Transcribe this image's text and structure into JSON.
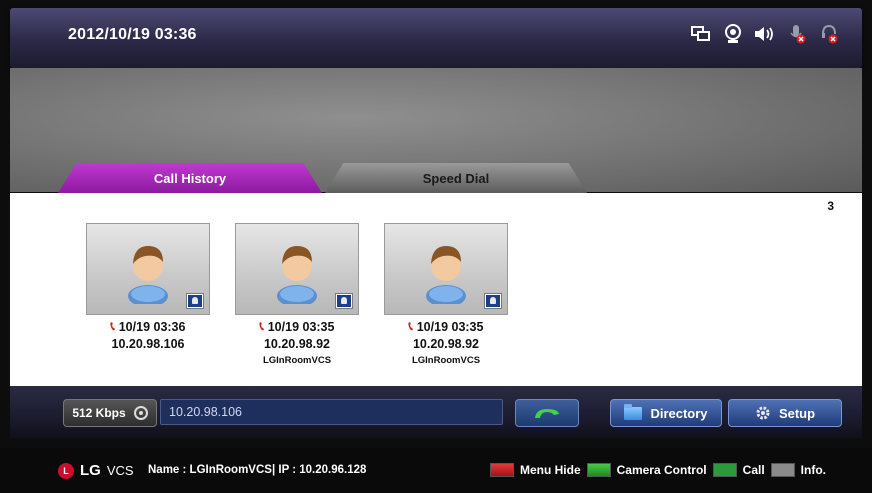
{
  "header": {
    "datetime": "2012/10/19 03:36",
    "status_icons": [
      "network-monitor-icon",
      "camera-icon",
      "speaker-icon",
      "mic-muted-icon",
      "headset-muted-icon"
    ]
  },
  "tabs": [
    {
      "label": "Call History",
      "active": true
    },
    {
      "label": "Speed Dial",
      "active": false
    }
  ],
  "history": {
    "count": "3",
    "items": [
      {
        "time": "10/19 03:36",
        "ip": "10.20.98.106",
        "name": ""
      },
      {
        "time": "10/19 03:35",
        "ip": "10.20.98.92",
        "name": "LGInRoomVCS"
      },
      {
        "time": "10/19 03:35",
        "ip": "10.20.98.92",
        "name": "LGInRoomVCS"
      }
    ]
  },
  "input_bar": {
    "bandwidth": "512 Kbps",
    "address_value": "10.20.98.106",
    "directory_label": "Directory",
    "setup_label": "Setup"
  },
  "footer": {
    "brand": "LG",
    "product": "VCS",
    "info": "Name : LGInRoomVCS| IP : 10.20.96.128",
    "legend": {
      "menu_hide": "Menu Hide",
      "camera_control": "Camera Control",
      "call": "Call",
      "info": "Info."
    }
  },
  "colors": {
    "active_tab": "#b02fc4",
    "inactive_tab": "#7a7a7a",
    "button_blue": "#2f4f95",
    "address_field": "#1e2f5e"
  }
}
